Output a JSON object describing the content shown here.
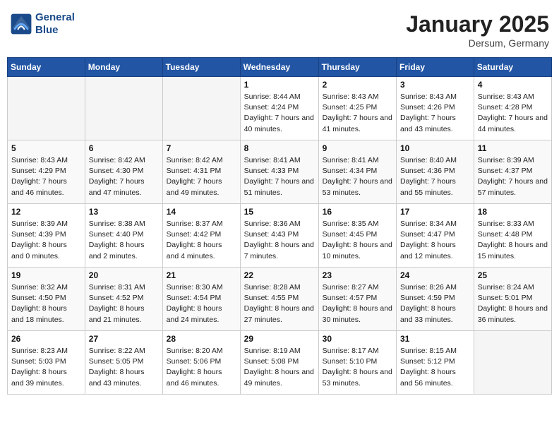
{
  "logo": {
    "name": "GeneralBlue"
  },
  "header": {
    "title": "January 2025",
    "location": "Dersum, Germany"
  },
  "weekdays": [
    "Sunday",
    "Monday",
    "Tuesday",
    "Wednesday",
    "Thursday",
    "Friday",
    "Saturday"
  ],
  "weeks": [
    [
      {
        "day": "",
        "empty": true
      },
      {
        "day": "",
        "empty": true
      },
      {
        "day": "",
        "empty": true
      },
      {
        "day": "1",
        "sunrise": "8:44 AM",
        "sunset": "4:24 PM",
        "daylight": "7 hours and 40 minutes."
      },
      {
        "day": "2",
        "sunrise": "8:43 AM",
        "sunset": "4:25 PM",
        "daylight": "7 hours and 41 minutes."
      },
      {
        "day": "3",
        "sunrise": "8:43 AM",
        "sunset": "4:26 PM",
        "daylight": "7 hours and 43 minutes."
      },
      {
        "day": "4",
        "sunrise": "8:43 AM",
        "sunset": "4:28 PM",
        "daylight": "7 hours and 44 minutes."
      }
    ],
    [
      {
        "day": "5",
        "sunrise": "8:43 AM",
        "sunset": "4:29 PM",
        "daylight": "7 hours and 46 minutes."
      },
      {
        "day": "6",
        "sunrise": "8:42 AM",
        "sunset": "4:30 PM",
        "daylight": "7 hours and 47 minutes."
      },
      {
        "day": "7",
        "sunrise": "8:42 AM",
        "sunset": "4:31 PM",
        "daylight": "7 hours and 49 minutes."
      },
      {
        "day": "8",
        "sunrise": "8:41 AM",
        "sunset": "4:33 PM",
        "daylight": "7 hours and 51 minutes."
      },
      {
        "day": "9",
        "sunrise": "8:41 AM",
        "sunset": "4:34 PM",
        "daylight": "7 hours and 53 minutes."
      },
      {
        "day": "10",
        "sunrise": "8:40 AM",
        "sunset": "4:36 PM",
        "daylight": "7 hours and 55 minutes."
      },
      {
        "day": "11",
        "sunrise": "8:39 AM",
        "sunset": "4:37 PM",
        "daylight": "7 hours and 57 minutes."
      }
    ],
    [
      {
        "day": "12",
        "sunrise": "8:39 AM",
        "sunset": "4:39 PM",
        "daylight": "8 hours and 0 minutes."
      },
      {
        "day": "13",
        "sunrise": "8:38 AM",
        "sunset": "4:40 PM",
        "daylight": "8 hours and 2 minutes."
      },
      {
        "day": "14",
        "sunrise": "8:37 AM",
        "sunset": "4:42 PM",
        "daylight": "8 hours and 4 minutes."
      },
      {
        "day": "15",
        "sunrise": "8:36 AM",
        "sunset": "4:43 PM",
        "daylight": "8 hours and 7 minutes."
      },
      {
        "day": "16",
        "sunrise": "8:35 AM",
        "sunset": "4:45 PM",
        "daylight": "8 hours and 10 minutes."
      },
      {
        "day": "17",
        "sunrise": "8:34 AM",
        "sunset": "4:47 PM",
        "daylight": "8 hours and 12 minutes."
      },
      {
        "day": "18",
        "sunrise": "8:33 AM",
        "sunset": "4:48 PM",
        "daylight": "8 hours and 15 minutes."
      }
    ],
    [
      {
        "day": "19",
        "sunrise": "8:32 AM",
        "sunset": "4:50 PM",
        "daylight": "8 hours and 18 minutes."
      },
      {
        "day": "20",
        "sunrise": "8:31 AM",
        "sunset": "4:52 PM",
        "daylight": "8 hours and 21 minutes."
      },
      {
        "day": "21",
        "sunrise": "8:30 AM",
        "sunset": "4:54 PM",
        "daylight": "8 hours and 24 minutes."
      },
      {
        "day": "22",
        "sunrise": "8:28 AM",
        "sunset": "4:55 PM",
        "daylight": "8 hours and 27 minutes."
      },
      {
        "day": "23",
        "sunrise": "8:27 AM",
        "sunset": "4:57 PM",
        "daylight": "8 hours and 30 minutes."
      },
      {
        "day": "24",
        "sunrise": "8:26 AM",
        "sunset": "4:59 PM",
        "daylight": "8 hours and 33 minutes."
      },
      {
        "day": "25",
        "sunrise": "8:24 AM",
        "sunset": "5:01 PM",
        "daylight": "8 hours and 36 minutes."
      }
    ],
    [
      {
        "day": "26",
        "sunrise": "8:23 AM",
        "sunset": "5:03 PM",
        "daylight": "8 hours and 39 minutes."
      },
      {
        "day": "27",
        "sunrise": "8:22 AM",
        "sunset": "5:05 PM",
        "daylight": "8 hours and 43 minutes."
      },
      {
        "day": "28",
        "sunrise": "8:20 AM",
        "sunset": "5:06 PM",
        "daylight": "8 hours and 46 minutes."
      },
      {
        "day": "29",
        "sunrise": "8:19 AM",
        "sunset": "5:08 PM",
        "daylight": "8 hours and 49 minutes."
      },
      {
        "day": "30",
        "sunrise": "8:17 AM",
        "sunset": "5:10 PM",
        "daylight": "8 hours and 53 minutes."
      },
      {
        "day": "31",
        "sunrise": "8:15 AM",
        "sunset": "5:12 PM",
        "daylight": "8 hours and 56 minutes."
      },
      {
        "day": "",
        "empty": true
      }
    ]
  ]
}
